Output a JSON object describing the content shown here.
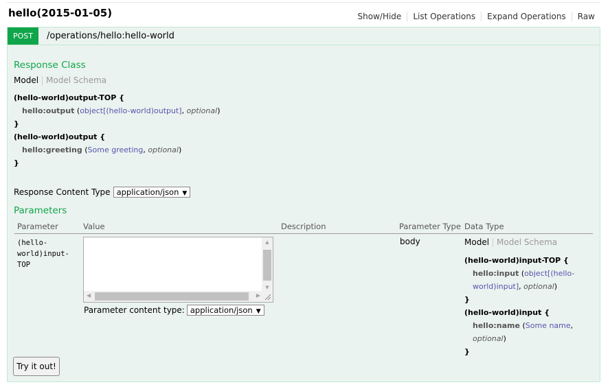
{
  "resource": {
    "title": "hello(2015-01-05)",
    "ops": [
      "Show/Hide",
      "List Operations",
      "Expand Operations",
      "Raw"
    ]
  },
  "operation": {
    "method": "POST",
    "path": "/operations/hello:hello-world"
  },
  "response": {
    "heading": "Response Class",
    "tab_model": "Model",
    "tab_schema": "Model Schema",
    "sig": {
      "out_top_open": "(hello-world)output-TOP {",
      "out_top_prop": "hello:output",
      "out_top_type": "object[(hello-world)output]",
      "out_top_opt": "optional",
      "close1": "}",
      "out_open": "(hello-world)output {",
      "out_prop": "hello:greeting",
      "out_type": "Some greeting",
      "out_opt": "optional",
      "close2": "}"
    },
    "content_type_label": "Response Content Type",
    "content_type_value": "application/json"
  },
  "parameters": {
    "heading": "Parameters",
    "columns": {
      "parameter": "Parameter",
      "value": "Value",
      "description": "Description",
      "param_type": "Parameter Type",
      "data_type": "Data Type"
    },
    "row": {
      "name_1": "(hello-",
      "name_2": "world)input-",
      "name_3": "TOP",
      "value": "",
      "content_type_label": "Parameter content type:",
      "content_type_value": "application/json",
      "param_type": "body",
      "tab_model": "Model",
      "tab_schema": "Model Schema",
      "sig": {
        "in_top_open": "(hello-world)input-TOP {",
        "in_top_prop": "hello:input",
        "in_top_type": "object[(hello-world)input]",
        "in_top_opt": "optional",
        "close1": "}",
        "in_open": "(hello-world)input {",
        "in_prop": "hello:name",
        "in_type": "Some name",
        "in_opt": "optional",
        "close2": "}"
      }
    }
  },
  "try_button": "Try it out!",
  "colors": {
    "method_bg": "#10a54a",
    "heading": "#10a54a",
    "panel_bg": "#ebf3f0",
    "panel_border": "#c3e8d1",
    "type_link": "#5555aa"
  },
  "icons": {
    "select_arrow": "down-triangle-icon",
    "resize_grip": "resize-grip-icon"
  }
}
